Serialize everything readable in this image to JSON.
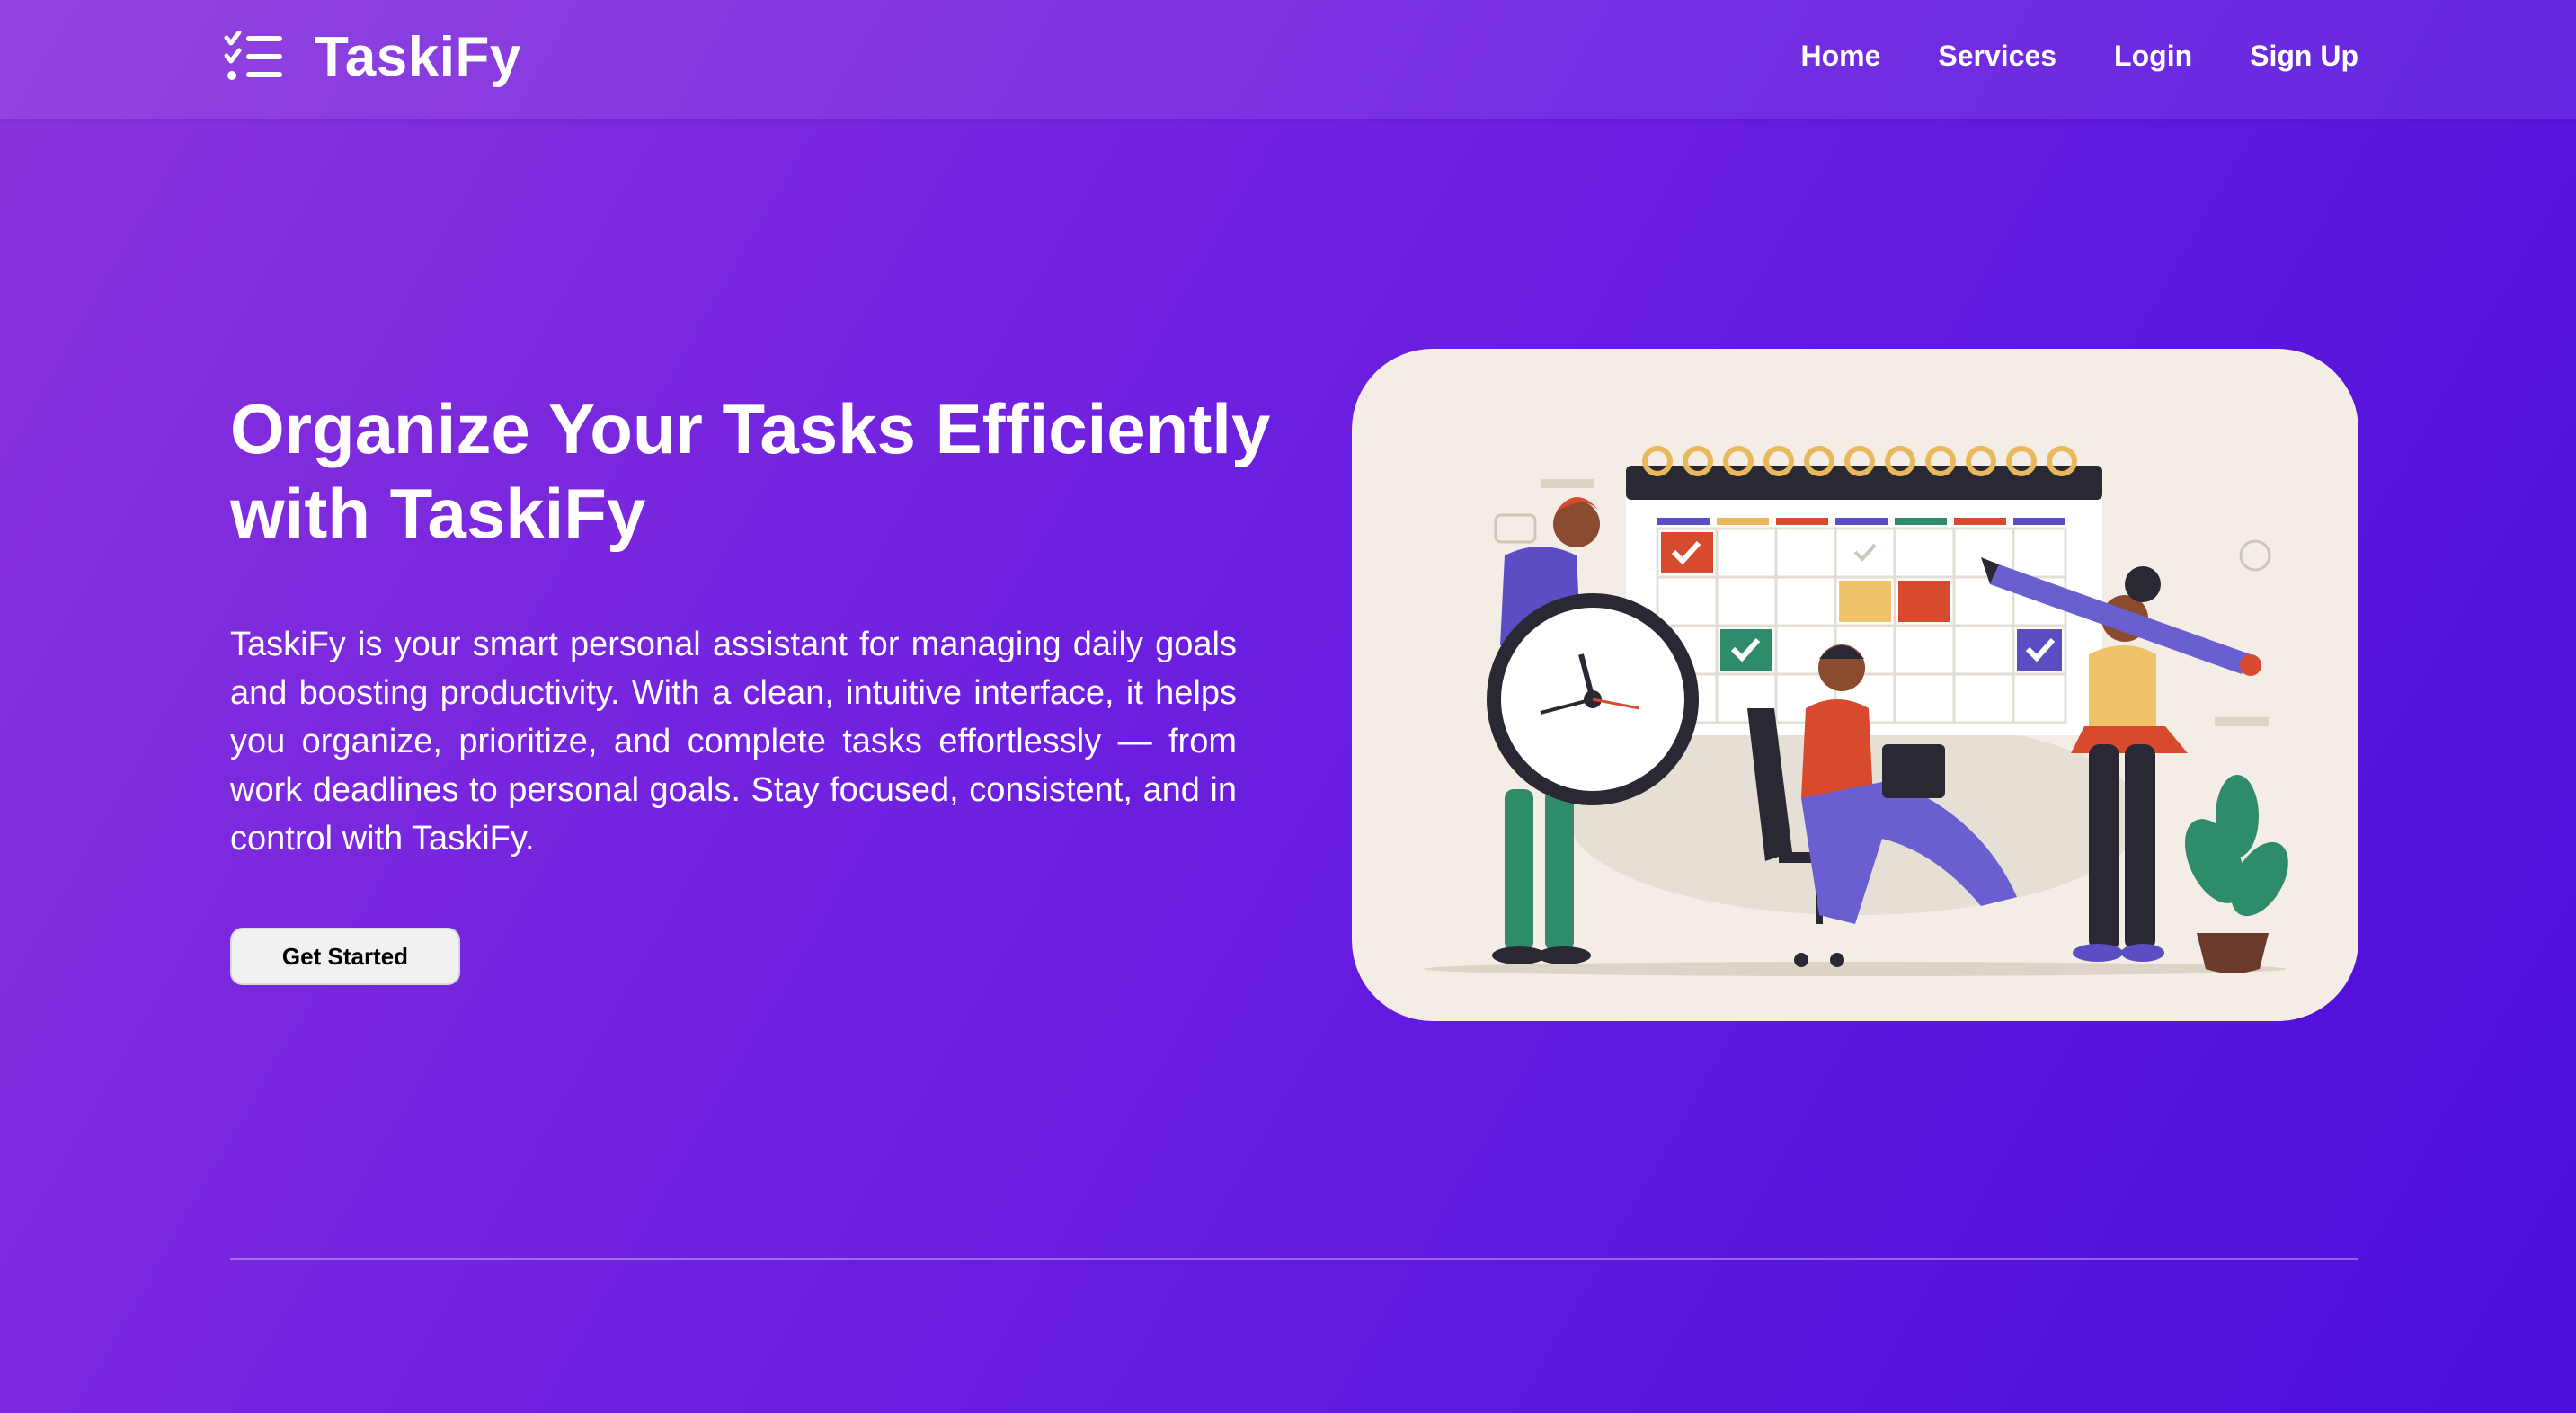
{
  "brand": {
    "name": "TaskiFy",
    "logo_icon": "checklist-icon"
  },
  "nav": {
    "links": [
      "Home",
      "Services",
      "Login",
      "Sign Up"
    ]
  },
  "hero": {
    "title": "Organize Your Tasks Efficiently with TaskiFy",
    "description": "TaskiFy is your smart personal assistant for managing daily goals and boosting productivity. With a clean, intuitive interface, it helps you organize, prioritize, and complete tasks effortlessly — from work deadlines to personal goals. Stay focused, consistent, and in control with TaskiFy.",
    "cta_label": "Get Started"
  },
  "illustration": {
    "subject": "productivity-scene-illustration"
  },
  "colors": {
    "gradient_start": "#8a33dc",
    "gradient_end": "#4a0edb",
    "card_bg": "#f3ede6",
    "button_bg": "#f1f1f1"
  }
}
